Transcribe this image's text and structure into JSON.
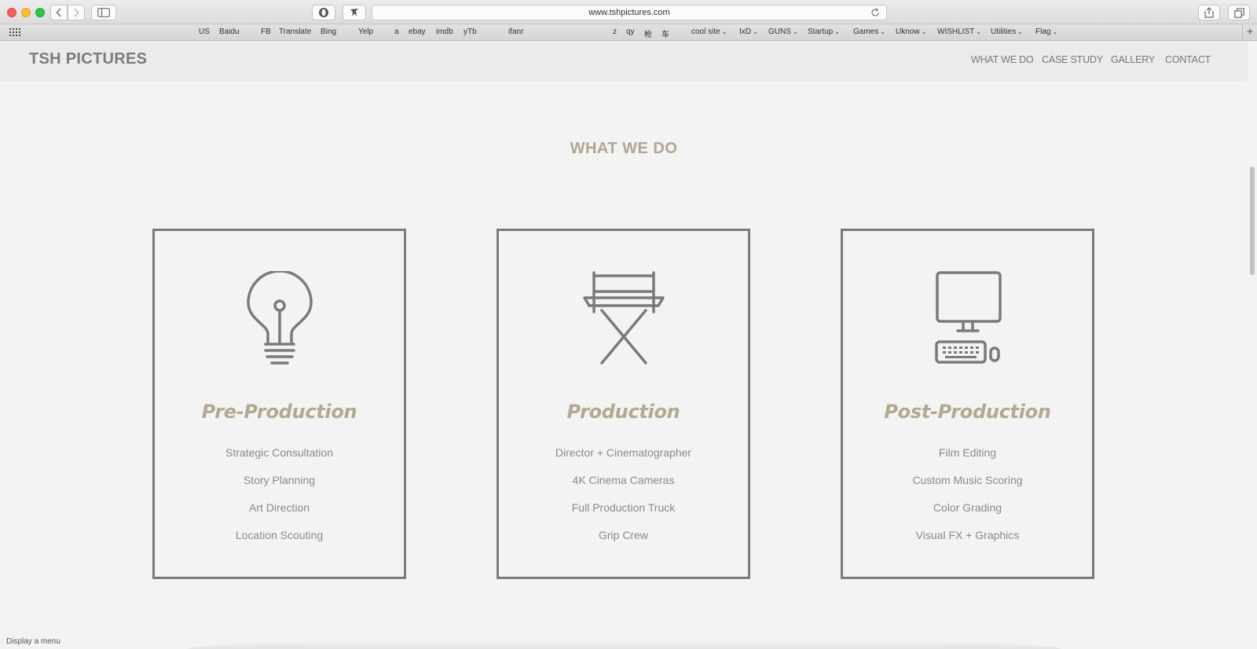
{
  "browser": {
    "url": "www.tshpictures.com",
    "bookmarks": [
      {
        "label": "US",
        "dropdown": false
      },
      {
        "label": "Baidu",
        "dropdown": false
      },
      {
        "label": "FB",
        "dropdown": false
      },
      {
        "label": "Translate",
        "dropdown": false
      },
      {
        "label": "Bing",
        "dropdown": false
      },
      {
        "label": "Yelp",
        "dropdown": false
      },
      {
        "label": "a",
        "dropdown": false
      },
      {
        "label": "ebay",
        "dropdown": false
      },
      {
        "label": "imdb",
        "dropdown": false
      },
      {
        "label": "yTb",
        "dropdown": false
      },
      {
        "label": "ifanr",
        "dropdown": false
      },
      {
        "label": "z",
        "dropdown": false
      },
      {
        "label": "qy",
        "dropdown": false
      },
      {
        "label": "枪",
        "dropdown": false
      },
      {
        "label": "车",
        "dropdown": false
      },
      {
        "label": "cool site",
        "dropdown": true
      },
      {
        "label": "IxD",
        "dropdown": true
      },
      {
        "label": "GUNS",
        "dropdown": true
      },
      {
        "label": "Startup",
        "dropdown": true
      },
      {
        "label": "Games",
        "dropdown": true
      },
      {
        "label": "Uknow",
        "dropdown": true
      },
      {
        "label": "WISHLIST",
        "dropdown": true
      },
      {
        "label": "Utilities",
        "dropdown": true
      },
      {
        "label": "Flag",
        "dropdown": true
      }
    ],
    "status_text": "Display a menu"
  },
  "site": {
    "logo": "TSH PICTURES",
    "nav": [
      "WHAT WE DO",
      "CASE STUDY",
      "GALLERY",
      "CONTACT"
    ],
    "section_title": "WHAT WE DO"
  },
  "services": [
    {
      "icon": "lightbulb-icon",
      "title": "Pre-Production",
      "items": [
        "Strategic Consultation",
        "Story Planning",
        "Art Direction",
        "Location Scouting"
      ]
    },
    {
      "icon": "director-chair-icon",
      "title": "Production",
      "items": [
        "Director + Cinematographer",
        "4K Cinema Cameras",
        "Full Production Truck",
        "Grip Crew"
      ]
    },
    {
      "icon": "computer-icon",
      "title": "Post-Production",
      "items": [
        "Film Editing",
        "Custom Music Scoring",
        "Color Grading",
        "Visual FX + Graphics"
      ]
    }
  ],
  "colors": {
    "accent": "#b3a58f",
    "icon_stroke": "#7a7a7a",
    "page_background": "#f3f3f3"
  }
}
